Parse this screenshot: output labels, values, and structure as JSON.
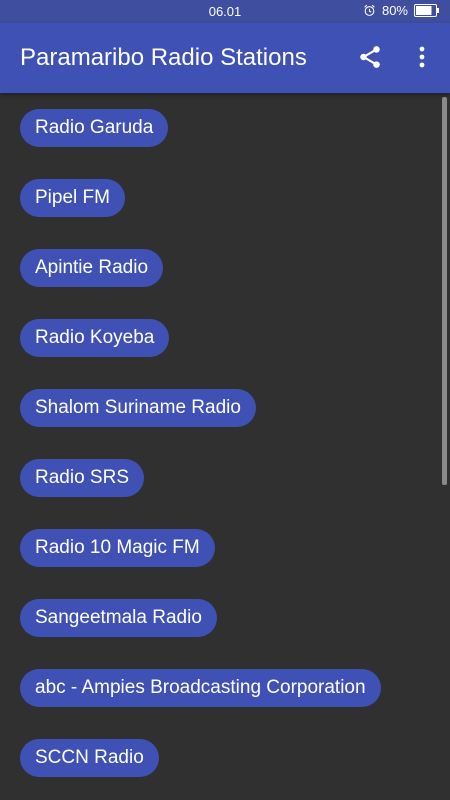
{
  "status_bar": {
    "time": "06.01",
    "battery": "80%"
  },
  "app_bar": {
    "title": "Paramaribo Radio Stations",
    "icons": [
      "share-icon",
      "more-vert-icon"
    ]
  },
  "colors": {
    "primary": "#3f51b5",
    "status_bar": "#3f4e9e",
    "background": "#303030",
    "text": "#ffffff"
  },
  "stations": [
    "Radio Garuda",
    "Pipel FM",
    "Apintie Radio",
    "Radio Koyeba",
    "Shalom Suriname Radio",
    "Radio SRS",
    "Radio 10 Magic FM",
    "Sangeetmala Radio",
    "abc - Ampies Broadcasting Corporation",
    "SCCN Radio"
  ]
}
